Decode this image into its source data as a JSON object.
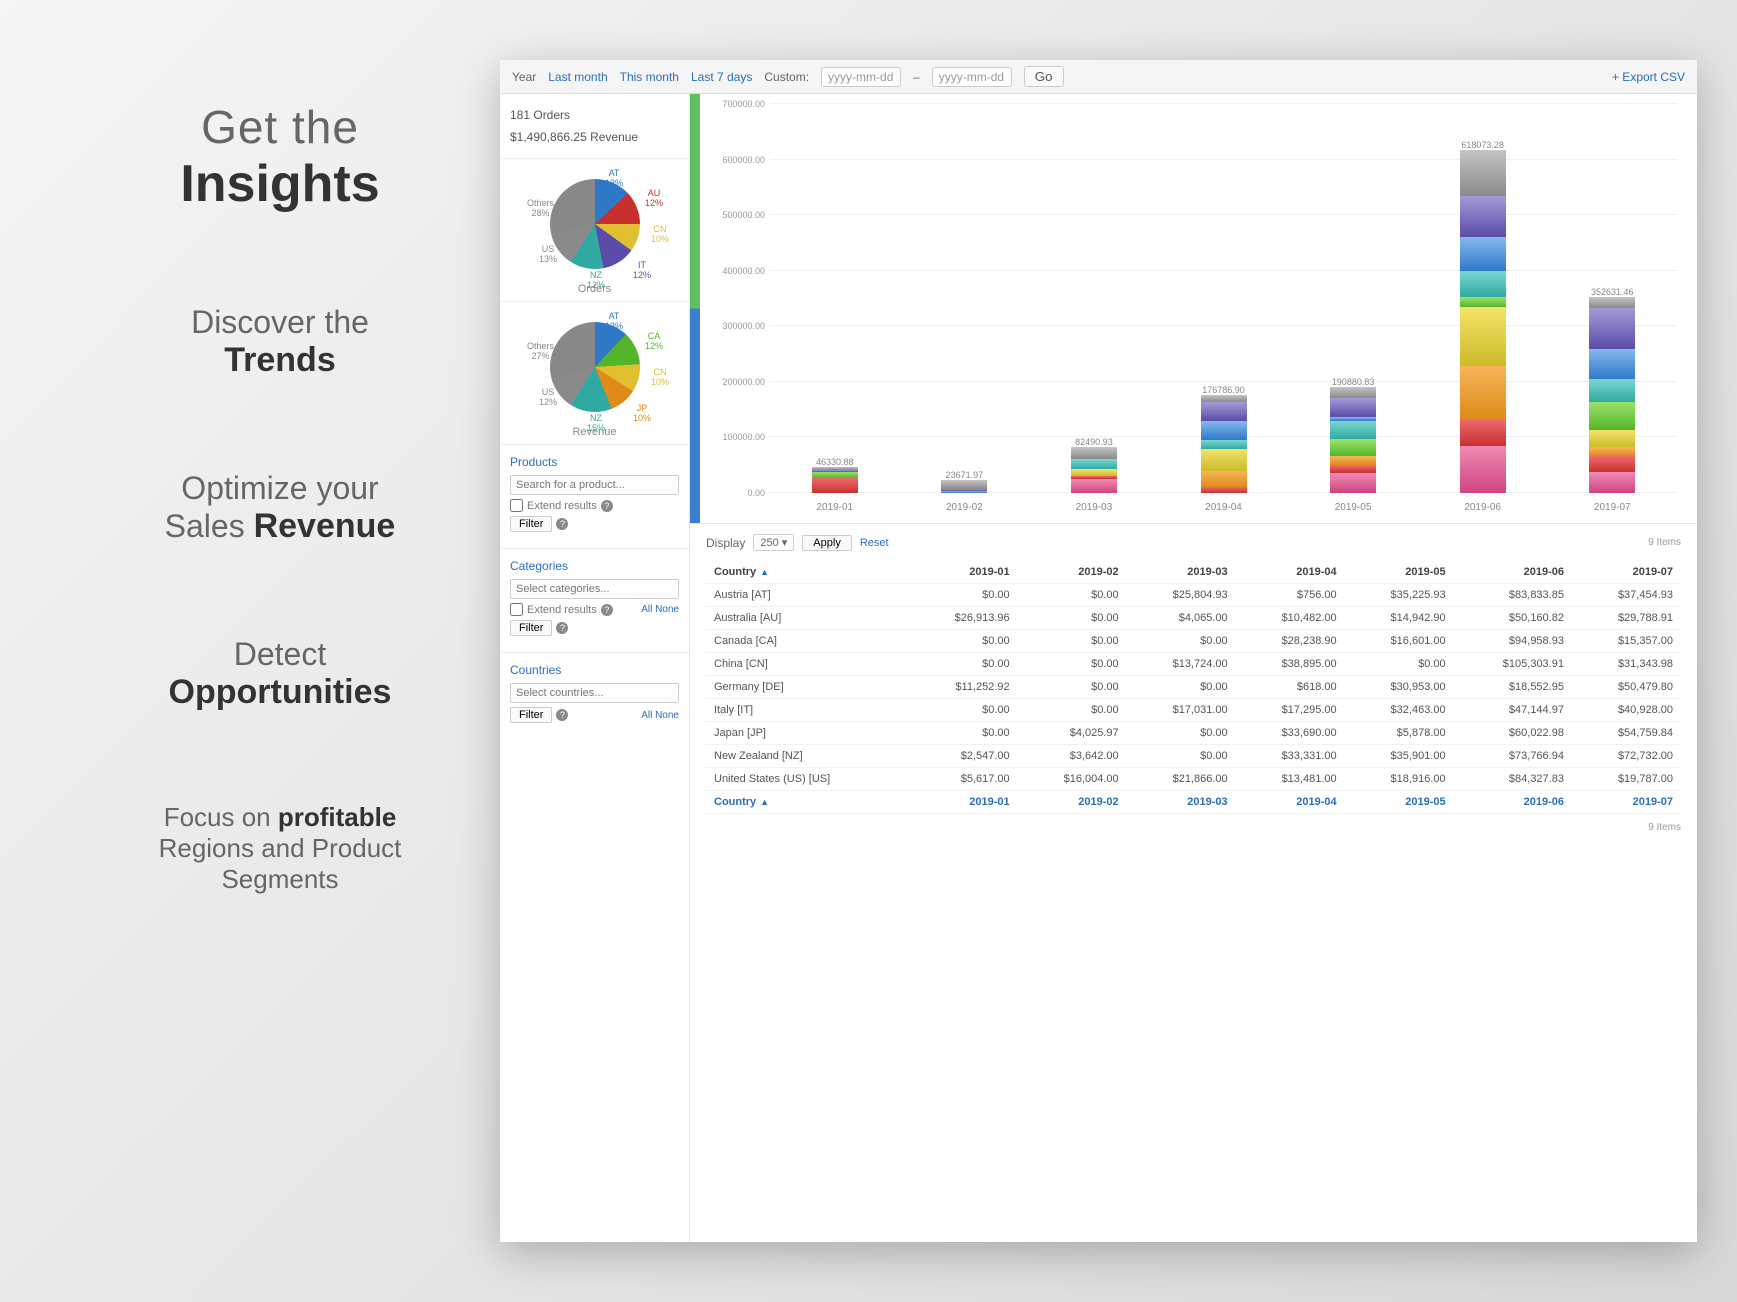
{
  "headline": {
    "l1a": "Get the",
    "l1b": "Insights",
    "l2a": "Discover the",
    "l2b": "Trends",
    "l3a": "Optimize your",
    "l3b1": "Sales ",
    "l3b2": "Revenue",
    "l4a": "Detect",
    "l4b": "Opportunities",
    "l5a": "Focus on ",
    "l5b": "profitable",
    "l5c": "Regions and Product",
    "l5d": "Segments"
  },
  "toolbar": {
    "year": "Year",
    "last_month": "Last month",
    "this_month": "This month",
    "last_7": "Last 7 days",
    "custom": "Custom:",
    "ph_from": "yyyy-mm-dd",
    "dash": "–",
    "ph_to": "yyyy-mm-dd",
    "go": "Go",
    "export": "+  Export CSV"
  },
  "kpi": {
    "orders": "181 Orders",
    "revenue": "$1,490,866.25 Revenue"
  },
  "pies": {
    "orders": {
      "title": "Orders",
      "labels": [
        {
          "text": "AT",
          "pct": "13%",
          "color": "#2f78c8"
        },
        {
          "text": "AU",
          "pct": "12%",
          "color": "#c83030"
        },
        {
          "text": "CN",
          "pct": "10%",
          "color": "#e0c030"
        },
        {
          "text": "IT",
          "pct": "12%",
          "color": "#5a4ca8"
        },
        {
          "text": "NZ",
          "pct": "12%",
          "color": "#2faaa2"
        },
        {
          "text": "US",
          "pct": "13%",
          "color": "#8a8a8a"
        },
        {
          "text": "Others",
          "pct": "28%",
          "color": "#888"
        }
      ]
    },
    "revenue": {
      "title": "Revenue",
      "labels": [
        {
          "text": "AT",
          "pct": "12%",
          "color": "#2f78c8"
        },
        {
          "text": "CA",
          "pct": "12%",
          "color": "#54b52a"
        },
        {
          "text": "CN",
          "pct": "10%",
          "color": "#e0c030"
        },
        {
          "text": "JP",
          "pct": "10%",
          "color": "#e08a1a"
        },
        {
          "text": "NZ",
          "pct": "15%",
          "color": "#2faaa2"
        },
        {
          "text": "US",
          "pct": "12%",
          "color": "#8a8a8a"
        },
        {
          "text": "Others",
          "pct": "27%",
          "color": "#888"
        }
      ]
    }
  },
  "filters": {
    "products": {
      "title": "Products",
      "ph": "Search for a product...",
      "extend": "Extend results",
      "filter": "Filter"
    },
    "categories": {
      "title": "Categories",
      "ph": "Select categories...",
      "extend": "Extend results",
      "filter": "Filter",
      "allnone": "All None"
    },
    "countries": {
      "title": "Countries",
      "ph": "Select countries...",
      "filter": "Filter",
      "allnone": "All None"
    }
  },
  "display": {
    "label": "Display",
    "value": "250",
    "apply": "Apply",
    "reset": "Reset",
    "items": "9 Items"
  },
  "table": {
    "headers": [
      "Country",
      "2019-01",
      "2019-02",
      "2019-03",
      "2019-04",
      "2019-05",
      "2019-06",
      "2019-07"
    ],
    "rows": [
      [
        "Austria [AT]",
        "$0.00",
        "$0.00",
        "$25,804.93",
        "$756.00",
        "$35,225.93",
        "$83,833.85",
        "$37,454.93"
      ],
      [
        "Australia [AU]",
        "$26,913.96",
        "$0.00",
        "$4,065.00",
        "$10,482.00",
        "$14,942.90",
        "$50,160.82",
        "$29,788.91"
      ],
      [
        "Canada [CA]",
        "$0.00",
        "$0.00",
        "$0.00",
        "$28,238.90",
        "$16,601.00",
        "$94,958.93",
        "$15,357.00"
      ],
      [
        "China [CN]",
        "$0.00",
        "$0.00",
        "$13,724.00",
        "$38,895.00",
        "$0.00",
        "$105,303.91",
        "$31,343.98"
      ],
      [
        "Germany [DE]",
        "$11,252.92",
        "$0.00",
        "$0.00",
        "$618.00",
        "$30,953.00",
        "$18,552.95",
        "$50,479.80"
      ],
      [
        "Italy [IT]",
        "$0.00",
        "$0.00",
        "$17,031.00",
        "$17,295.00",
        "$32,463.00",
        "$47,144.97",
        "$40,928.00"
      ],
      [
        "Japan [JP]",
        "$0.00",
        "$4,025.97",
        "$0.00",
        "$33,690.00",
        "$5,878.00",
        "$60,022.98",
        "$54,759.84"
      ],
      [
        "New Zealand [NZ]",
        "$2,547.00",
        "$3,642.00",
        "$0.00",
        "$33,331.00",
        "$35,901.00",
        "$73,766.94",
        "$72,732.00"
      ],
      [
        "United States (US) [US]",
        "$5,617.00",
        "$16,004.00",
        "$21,866.00",
        "$13,481.00",
        "$18,916.00",
        "$84,327.83",
        "$19,787.00"
      ]
    ],
    "footer_items": "9 Items"
  },
  "chart_data": {
    "type": "bar",
    "title": "",
    "ylabel": "",
    "xlabel": "",
    "ylim": [
      0,
      700000
    ],
    "yticks": [
      "0.00",
      "100000.00",
      "200000.00",
      "300000.00",
      "400000.00",
      "500000.00",
      "600000.00",
      "700000.00"
    ],
    "categories": [
      "2019-01",
      "2019-02",
      "2019-03",
      "2019-04",
      "2019-05",
      "2019-06",
      "2019-07"
    ],
    "totals": [
      46330.88,
      23671.97,
      82490.93,
      176786.9,
      190880.83,
      618073.28,
      352631.46
    ],
    "series": [
      {
        "name": "Austria [AT]",
        "values": [
          0,
          0,
          25804.93,
          756,
          35225.93,
          83833.85,
          37454.93
        ]
      },
      {
        "name": "Australia [AU]",
        "values": [
          26913.96,
          0,
          4065,
          10482,
          14942.9,
          50160.82,
          29788.91
        ]
      },
      {
        "name": "Canada [CA]",
        "values": [
          0,
          0,
          0,
          28238.9,
          16601,
          94958.93,
          15357
        ]
      },
      {
        "name": "China [CN]",
        "values": [
          0,
          0,
          13724,
          38895,
          0,
          105303.91,
          31343.98
        ]
      },
      {
        "name": "Germany [DE]",
        "values": [
          11252.92,
          0,
          0,
          618,
          30953,
          18552.95,
          50479.8
        ]
      },
      {
        "name": "Italy [IT]",
        "values": [
          0,
          0,
          17031,
          17295,
          32463,
          47144.97,
          40928
        ]
      },
      {
        "name": "Japan [JP]",
        "values": [
          0,
          4025.97,
          0,
          33690,
          5878,
          60022.98,
          54759.84
        ]
      },
      {
        "name": "New Zealand [NZ]",
        "values": [
          2547,
          3642,
          0,
          33331,
          35901,
          73766.94,
          72732
        ]
      },
      {
        "name": "United States (US) [US]",
        "values": [
          5617,
          16004,
          21866,
          13481,
          18916,
          84327.83,
          19787
        ]
      }
    ]
  }
}
